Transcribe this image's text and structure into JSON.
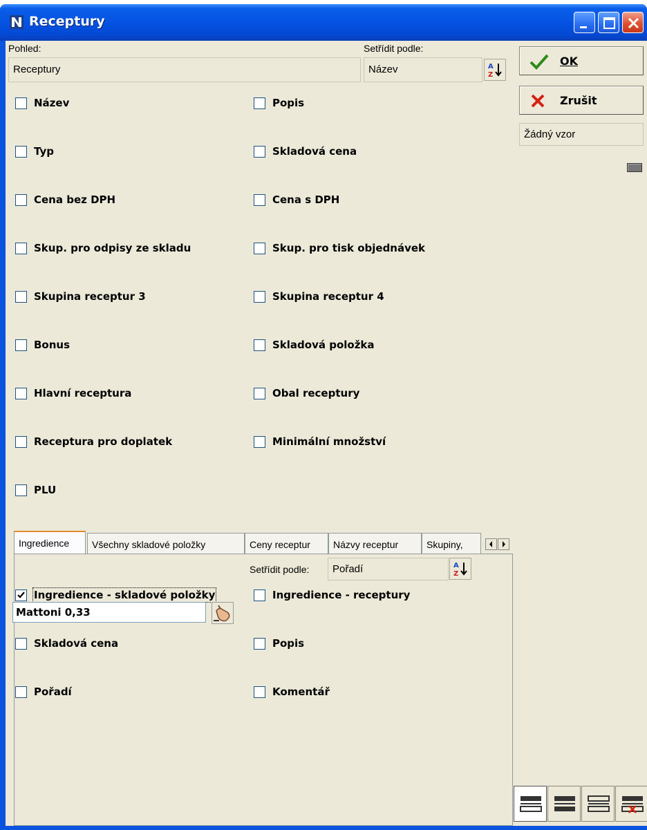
{
  "window": {
    "title": "Receptury"
  },
  "view": {
    "label": "Pohled:",
    "value": "Receptury"
  },
  "sort": {
    "label": "Setřídit podle:",
    "value": "Název"
  },
  "buttons": {
    "ok": "OK",
    "cancel": "Zrušit"
  },
  "pattern": {
    "value": "Žádný vzor"
  },
  "fields_left": [
    {
      "label": "Název",
      "checked": false
    },
    {
      "label": "Typ",
      "checked": false
    },
    {
      "label": "Cena bez DPH",
      "checked": false
    },
    {
      "label": "Skup. pro odpisy ze skladu",
      "checked": false
    },
    {
      "label": "Skupina receptur 3",
      "checked": false
    },
    {
      "label": "Bonus",
      "checked": false
    },
    {
      "label": "Hlavní receptura",
      "checked": false
    },
    {
      "label": "Receptura pro doplatek",
      "checked": false
    },
    {
      "label": "PLU",
      "checked": false
    }
  ],
  "fields_right": [
    {
      "label": "Popis",
      "checked": false
    },
    {
      "label": "Skladová cena",
      "checked": false
    },
    {
      "label": "Cena s DPH",
      "checked": false
    },
    {
      "label": "Skup. pro tisk objednávek",
      "checked": false
    },
    {
      "label": "Skupina receptur 4",
      "checked": false
    },
    {
      "label": "Skladová položka",
      "checked": false
    },
    {
      "label": "Obal receptury",
      "checked": false
    },
    {
      "label": "Minimální množství",
      "checked": false
    }
  ],
  "tabs": [
    {
      "label": "Ingredience",
      "active": true
    },
    {
      "label": "Všechny skladové položky",
      "active": false
    },
    {
      "label": "Ceny receptur",
      "active": false
    },
    {
      "label": "Názvy receptur",
      "active": false
    },
    {
      "label": "Skupiny,",
      "active": false
    }
  ],
  "tab_panel": {
    "sort_label": "Setřídit podle:",
    "sort_value": "Pořadí",
    "ingredient_value": "Mattoni 0,33",
    "fields_left": [
      {
        "label": "Ingredience - skladové položky",
        "checked": true
      },
      {
        "label": "Skladová cena",
        "checked": false
      },
      {
        "label": "Pořadí",
        "checked": false
      }
    ],
    "fields_right": [
      {
        "label": "Ingredience - receptury",
        "checked": false
      },
      {
        "label": "Popis",
        "checked": false
      },
      {
        "label": "Komentář",
        "checked": false
      }
    ]
  },
  "colors": {
    "titlebar": "#0553e3",
    "dialog": "#ece9d8",
    "ok_check": "#2a8a1a",
    "cancel_x": "#d82010"
  }
}
